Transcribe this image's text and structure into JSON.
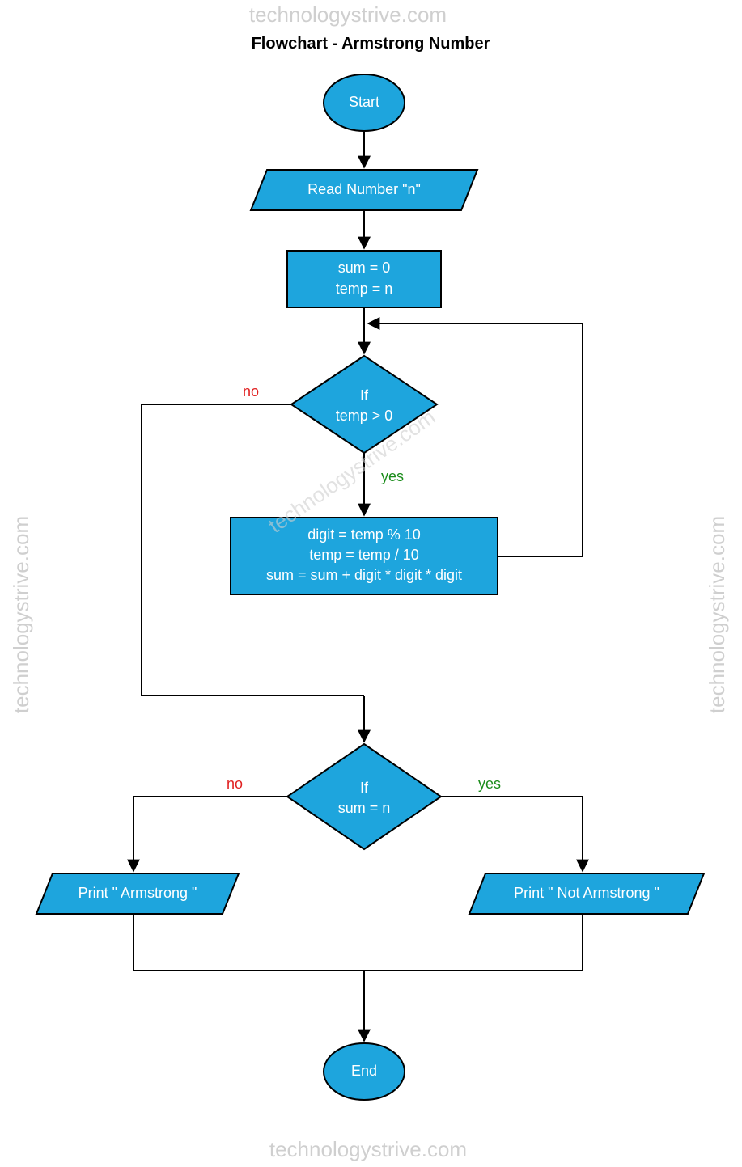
{
  "title": "Flowchart - Armstrong Number",
  "watermark": "technologystrive.com",
  "nodes": {
    "start": "Start",
    "read": "Read Number \"n\"",
    "init": {
      "l1": "sum = 0",
      "l2": "temp = n"
    },
    "cond1": {
      "l1": "If",
      "l2": "temp > 0"
    },
    "loop": {
      "l1": "digit = temp % 10",
      "l2": "temp = temp / 10",
      "l3": "sum = sum + digit * digit * digit"
    },
    "cond2": {
      "l1": "If",
      "l2": "sum = n"
    },
    "printYes": "Print \" Armstrong \"",
    "printNo": "Print \" Not Armstrong \"",
    "end": "End"
  },
  "edgeLabels": {
    "yes": "yes",
    "no": "no"
  }
}
